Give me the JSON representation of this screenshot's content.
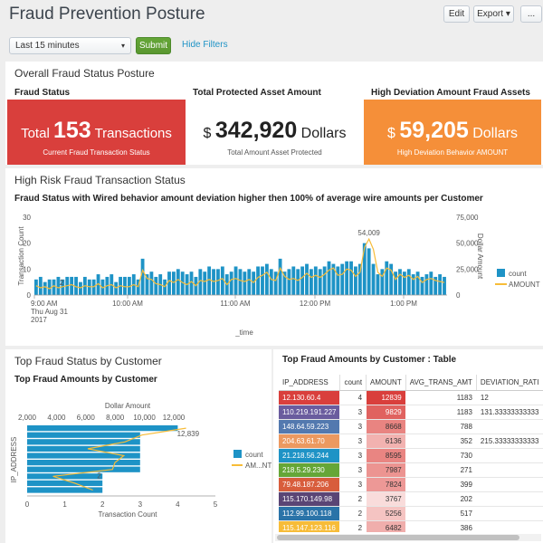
{
  "header": {
    "title": "Fraud Prevention Posture",
    "edit_label": "Edit",
    "export_label": "Export ▾",
    "more_label": "..."
  },
  "controls": {
    "time_range": "Last 15 minutes",
    "submit_label": "Submit",
    "hide_filters_label": "Hide Filters"
  },
  "overall": {
    "title": "Overall Fraud Status Posture",
    "kpis": [
      {
        "header": "Fraud Status",
        "prefix": "Total ",
        "value": "153",
        "unit": " Transactions",
        "subtitle": "Current Fraud Transaction Status",
        "bg": "#d93f3c",
        "fg": "#ffffff"
      },
      {
        "header": "Total Protected Asset Amount",
        "prefix": "$ ",
        "value": "342,920",
        "unit": " Dollars",
        "subtitle": "Total Amount Asset Protected",
        "bg": "#ffffff",
        "fg": "#222222"
      },
      {
        "header": "High Deviation Amount Fraud Assets",
        "prefix": "$ ",
        "value": "59,205",
        "unit": " Dollars",
        "subtitle": "High Deviation Behavior AMOUNT",
        "bg": "#f58f39",
        "fg": "#ffffff"
      }
    ]
  },
  "high_risk": {
    "title": "High Risk Fraud Transaction Status",
    "chart_title": "Fraud Status with Wired behavior amount deviation higher then 100% of average wire amounts per Customer"
  },
  "top_customer": {
    "title": "Top Fraud Status by Customer",
    "chart_title": "Top Fraud Amounts by Customer"
  },
  "table_panel": {
    "title": "Top Fraud Amounts by Customer : Table",
    "columns": [
      "IP_ADDRESS",
      "count",
      "AMOUNT",
      "AVG_TRANS_AMT",
      "DEVIATION_RATI"
    ],
    "rows": [
      {
        "ip": "12.130.60.4",
        "ip_color": "#d93f3c",
        "count": "4",
        "amount": "12839",
        "amount_color": "#d93f3c",
        "avg": "1183",
        "dev": "12"
      },
      {
        "ip": "110.219.191.227",
        "ip_color": "#6a5c9e",
        "count": "3",
        "amount": "9829",
        "amount_color": "#e0625f",
        "avg": "1183",
        "dev": "131.33333333333"
      },
      {
        "ip": "148.64.59.223",
        "ip_color": "#5379af",
        "count": "3",
        "amount": "8668",
        "amount_color": "#e98481",
        "avg": "788",
        "dev": ""
      },
      {
        "ip": "204.63.61.70",
        "ip_color": "#ec9960",
        "count": "3",
        "amount": "6136",
        "amount_color": "#f2b2b0",
        "avg": "352",
        "dev": "215.33333333333"
      },
      {
        "ip": "21.218.56.244",
        "ip_color": "#1e93c6",
        "count": "3",
        "amount": "8595",
        "amount_color": "#e98582",
        "avg": "730",
        "dev": ""
      },
      {
        "ip": "218.5.29.230",
        "ip_color": "#65a637",
        "count": "3",
        "amount": "7987",
        "amount_color": "#ec9491",
        "avg": "271",
        "dev": ""
      },
      {
        "ip": "79.48.187.206",
        "ip_color": "#d85d3c",
        "count": "3",
        "amount": "7824",
        "amount_color": "#ed9896",
        "avg": "399",
        "dev": ""
      },
      {
        "ip": "115.170.149.98",
        "ip_color": "#5a4575",
        "count": "2",
        "amount": "3767",
        "amount_color": "#f9dcdb",
        "avg": "202",
        "dev": ""
      },
      {
        "ip": "112.99.100.118",
        "ip_color": "#2a73a8",
        "count": "2",
        "amount": "5256",
        "amount_color": "#f5c4c2",
        "avg": "517",
        "dev": ""
      },
      {
        "ip": "115.147.123.116",
        "ip_color": "#f7bc38",
        "count": "2",
        "amount": "6482",
        "amount_color": "#f0aeac",
        "avg": "386",
        "dev": ""
      }
    ]
  },
  "colors": {
    "bar": "#1e93c6",
    "line": "#f7bc38",
    "red": "#d93f3c",
    "orange": "#f58f39",
    "green": "#65a637"
  },
  "chart_data": [
    {
      "type": "bar",
      "title": "Fraud Status with Wired behavior amount deviation higher then 100% of average wire amounts per Customer",
      "xlabel": "_time",
      "ylabel": "Transaction Count",
      "y2label": "Dollar Amount",
      "ylim": [
        0,
        30
      ],
      "y2lim": [
        0,
        75000
      ],
      "yticks": [
        "30",
        "20",
        "10",
        "0"
      ],
      "y2ticks": [
        "75,000",
        "50,000",
        "25,000",
        "0"
      ],
      "xticks": [
        "9:00 AM",
        "10:00 AM",
        "11:00 AM",
        "12:00 PM",
        "1:00 PM"
      ],
      "xtick_date": [
        "Thu Aug 31",
        "2017"
      ],
      "legend_position": "right",
      "series": [
        {
          "name": "count",
          "kind": "bar",
          "values": [
            6,
            7,
            5,
            6,
            6,
            7,
            6,
            7,
            7,
            7,
            5,
            7,
            6,
            6,
            8,
            6,
            7,
            8,
            5,
            7,
            7,
            7,
            8,
            6,
            14,
            8,
            9,
            7,
            8,
            6,
            9,
            9,
            10,
            9,
            8,
            9,
            7,
            10,
            9,
            11,
            10,
            10,
            11,
            8,
            9,
            11,
            10,
            9,
            10,
            9,
            11,
            11,
            12,
            10,
            9,
            14,
            9,
            10,
            11,
            10,
            11,
            12,
            10,
            11,
            10,
            11,
            13,
            12,
            11,
            12,
            13,
            13,
            11,
            12,
            20,
            18,
            12,
            8,
            10,
            13,
            12,
            9,
            10,
            9,
            10,
            8,
            9,
            7,
            8,
            9,
            7,
            8,
            7
          ]
        },
        {
          "name": "AMOUNT",
          "kind": "line",
          "values": [
            9000,
            7000,
            8000,
            6000,
            9000,
            7000,
            8000,
            9000,
            10000,
            8000,
            7000,
            9000,
            8000,
            8000,
            11000,
            7000,
            9000,
            10000,
            7000,
            9000,
            8000,
            8000,
            10000,
            8000,
            24000,
            16000,
            15000,
            11000,
            10000,
            8000,
            14000,
            12000,
            15000,
            12000,
            10000,
            13000,
            9000,
            14000,
            13000,
            15000,
            13000,
            14000,
            16000,
            10000,
            15000,
            16000,
            14000,
            13000,
            15000,
            12000,
            17000,
            19000,
            22000,
            15000,
            14000,
            26000,
            18000,
            15000,
            16000,
            14000,
            17000,
            21000,
            17000,
            19000,
            17000,
            20000,
            24000,
            26000,
            19000,
            20000,
            25000,
            24000,
            18000,
            22000,
            46000,
            54009,
            44000,
            22000,
            18000,
            26000,
            24000,
            15000,
            20000,
            17000,
            19000,
            15000,
            18000,
            12000,
            15000,
            16000,
            14000,
            13000,
            12000
          ]
        }
      ],
      "annotations": [
        "54,009",
        "2"
      ]
    },
    {
      "type": "bar",
      "orientation": "horizontal",
      "title": "Top Fraud Amounts by Customer",
      "xlabel": "Transaction Count",
      "x2label": "Dollar Amount",
      "ylabel": "IP_ADDRESS",
      "xlim": [
        0,
        5
      ],
      "x2lim": [
        2000,
        12000
      ],
      "xticks": [
        "0",
        "1",
        "2",
        "3",
        "4",
        "5"
      ],
      "x2ticks": [
        "2,000",
        "4,000",
        "6,000",
        "8,000",
        "10,000",
        "12,000"
      ],
      "legend_position": "right",
      "series": [
        {
          "name": "count",
          "kind": "bar",
          "values": [
            4,
            3,
            3,
            3,
            3,
            3,
            3,
            2,
            2,
            2
          ]
        },
        {
          "name": "AM...NT",
          "kind": "line",
          "values": [
            12839,
            9829,
            8668,
            6136,
            8595,
            7987,
            7824,
            3767,
            5256,
            6482
          ]
        }
      ],
      "annotations": [
        "12,839",
        "2"
      ]
    }
  ]
}
